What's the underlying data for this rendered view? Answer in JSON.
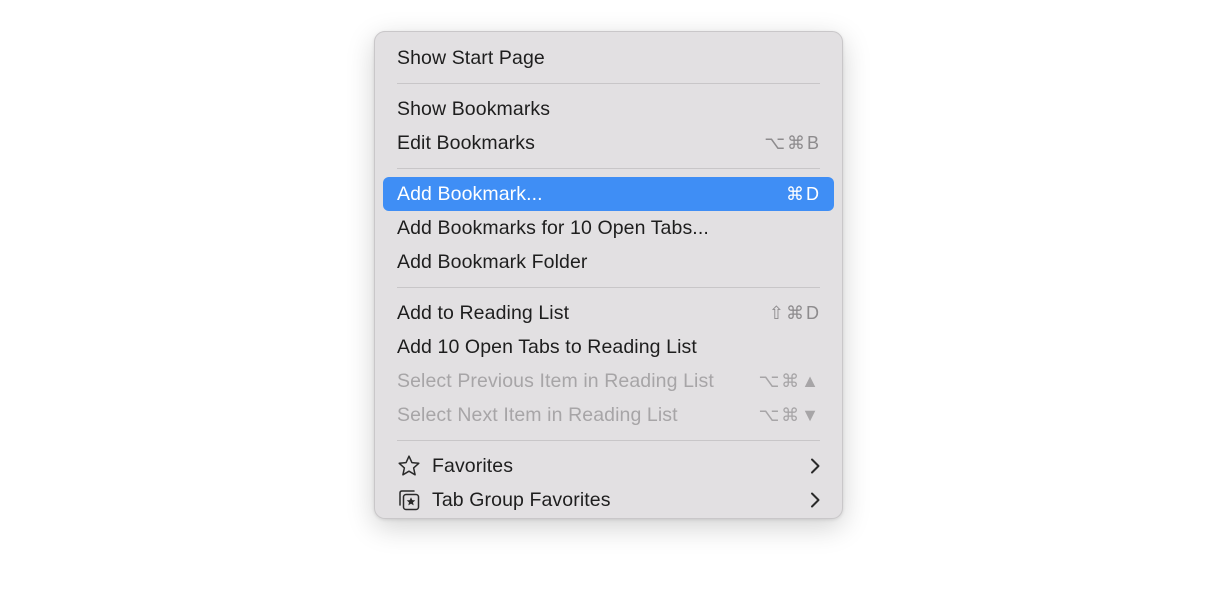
{
  "menu": {
    "items": [
      {
        "label": "Show Start Page",
        "shortcut": ""
      },
      {
        "label": "Show Bookmarks",
        "shortcut": ""
      },
      {
        "label": "Edit Bookmarks",
        "shortcut": "⌥⌘B"
      },
      {
        "label": "Add Bookmark...",
        "shortcut": "⌘D"
      },
      {
        "label": "Add Bookmarks for 10 Open Tabs...",
        "shortcut": ""
      },
      {
        "label": "Add Bookmark Folder",
        "shortcut": ""
      },
      {
        "label": "Add to Reading List",
        "shortcut": "⇧⌘D"
      },
      {
        "label": "Add 10 Open Tabs to Reading List",
        "shortcut": ""
      },
      {
        "label": "Select Previous Item in Reading List",
        "shortcut": "⌥⌘▲"
      },
      {
        "label": "Select Next Item in Reading List",
        "shortcut": "⌥⌘▼"
      },
      {
        "label": "Favorites",
        "icon": "star-icon"
      },
      {
        "label": "Tab Group Favorites",
        "icon": "tab-group-star-icon"
      }
    ]
  },
  "colors": {
    "highlight": "#3f8ef5",
    "menu_background": "#e2e0e2",
    "text": "#1e1e1e",
    "disabled_text": "#a7a5a7",
    "shortcut_text": "#8d8b8d"
  }
}
